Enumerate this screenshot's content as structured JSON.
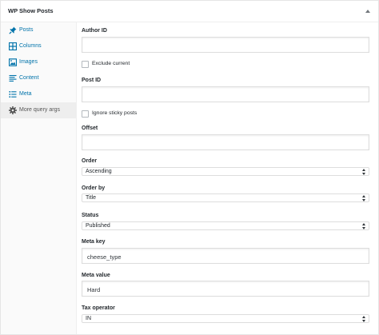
{
  "metabox": {
    "title": "WP Show Posts"
  },
  "sidebar": {
    "items": [
      {
        "label": "Posts",
        "icon": "pin-icon"
      },
      {
        "label": "Columns",
        "icon": "columns-icon"
      },
      {
        "label": "Images",
        "icon": "image-icon"
      },
      {
        "label": "Content",
        "icon": "content-icon"
      },
      {
        "label": "Meta",
        "icon": "list-icon"
      },
      {
        "label": "More query args",
        "icon": "gear-icon",
        "active": true
      }
    ]
  },
  "fields": {
    "author_id": {
      "label": "Author ID",
      "value": ""
    },
    "exclude_current": {
      "label": "Exclude current",
      "checked": false
    },
    "post_id": {
      "label": "Post ID",
      "value": ""
    },
    "ignore_sticky": {
      "label": "Ignore sticky posts",
      "checked": false
    },
    "offset": {
      "label": "Offset",
      "value": ""
    },
    "order": {
      "label": "Order",
      "value": "Ascending"
    },
    "order_by": {
      "label": "Order by",
      "value": "Title"
    },
    "status": {
      "label": "Status",
      "value": "Published"
    },
    "meta_key": {
      "label": "Meta key",
      "value": "cheese_type"
    },
    "meta_value": {
      "label": "Meta value",
      "value": "Hard"
    },
    "tax_operator": {
      "label": "Tax operator",
      "value": "IN"
    }
  },
  "colors": {
    "accent": "#0073aa",
    "border": "#dddddd",
    "sidebar_bg": "#fafafa"
  }
}
